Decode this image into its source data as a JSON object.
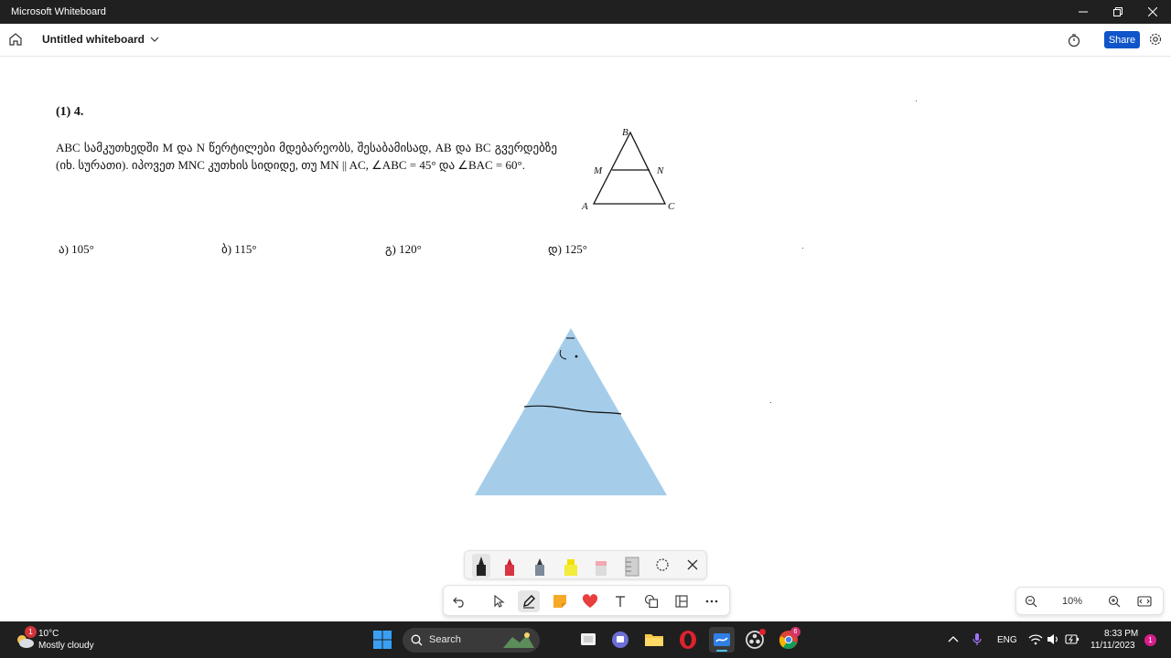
{
  "window": {
    "title": "Microsoft Whiteboard"
  },
  "appbar": {
    "doc_title": "Untitled whiteboard",
    "share_label": "Share"
  },
  "problem": {
    "number": "(1) 4.",
    "text": "ABC სამკუთხედში M და N წერტილები მდებარეობს, შესაბამისად, AB და BC გვერდებზე (იხ. სურათი). იპოვეთ MNC კუთხის სიდიდე, თუ MN || AC, ∠ABC = 45° და ∠BAC = 60°.",
    "answers": [
      "ა) 105°",
      "ბ) 115°",
      "გ) 120°",
      "დ) 125°"
    ],
    "figure_labels": {
      "b": "B",
      "m": "M",
      "n": "N",
      "a": "A",
      "c": "C"
    }
  },
  "zoom": {
    "value": "10%"
  },
  "taskbar": {
    "weather_badge": "1",
    "weather_temp": "10°C",
    "weather_desc": "Mostly cloudy",
    "search_label": "Search",
    "lang": "ENG",
    "time": "8:33 PM",
    "date": "11/11/2023",
    "chrome_badge": "6",
    "notif_badge": "1"
  },
  "colors": {
    "shape_fill": "#a5cdea",
    "share_button": "#0f54c9",
    "titlebar": "#202020",
    "taskbar": "#1f1f1f"
  }
}
